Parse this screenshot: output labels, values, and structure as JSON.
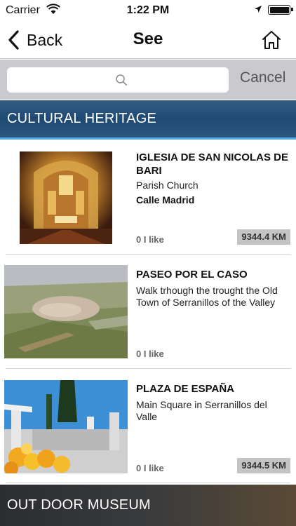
{
  "status_bar": {
    "carrier": "Carrier",
    "time": "1:22 PM"
  },
  "nav": {
    "back_label": "Back",
    "title": "See"
  },
  "search": {
    "placeholder": "",
    "cancel_label": "Cancel"
  },
  "sections": {
    "cultural_heritage": "CULTURAL HERITAGE",
    "outdoor_museum": "OUT DOOR MUSEUM"
  },
  "items": [
    {
      "title": "IGLESIA DE SAN NICOLAS DE BARI",
      "subtitle": "Parish Church",
      "street": "Calle Madrid",
      "likes": "0 I like",
      "distance": "9344.4 KM"
    },
    {
      "title": "PASEO POR EL CASO",
      "subtitle": "Walk trhough the trought the Old Town of Serranillos of the Valley",
      "street": "",
      "likes": "0 I like",
      "distance": ""
    },
    {
      "title": "PLAZA DE ESPAÑA",
      "subtitle": "Main Square in Serranillos del Valle",
      "street": "",
      "likes": "0 I like",
      "distance": "9344.5 KM"
    }
  ]
}
